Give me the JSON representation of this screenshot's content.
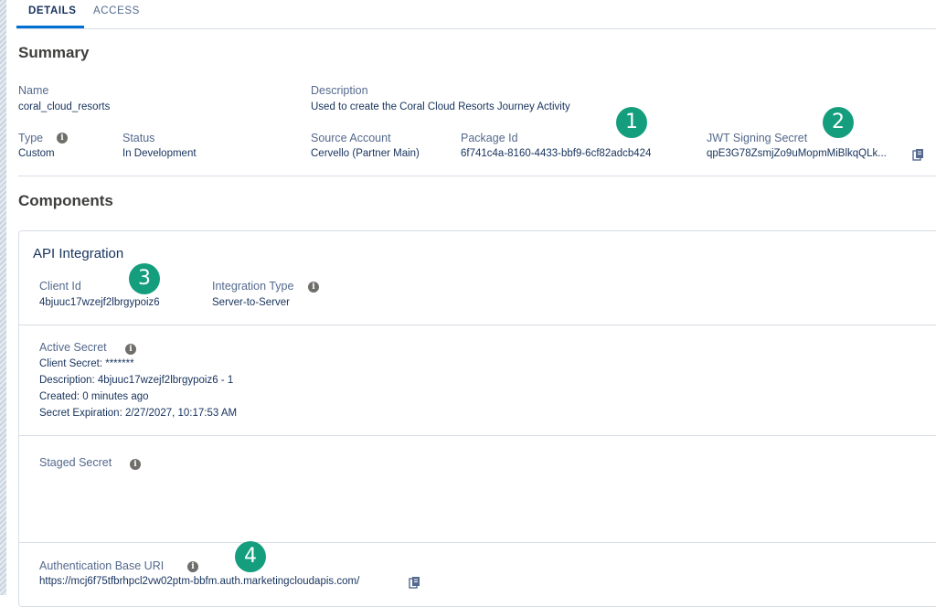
{
  "tabs": [
    {
      "label": "DETAILS",
      "active": true
    },
    {
      "label": "ACCESS",
      "active": false
    }
  ],
  "summary": {
    "title": "Summary",
    "name_label": "Name",
    "name_value": "coral_cloud_resorts",
    "description_label": "Description",
    "description_value": "Used to create the Coral Cloud Resorts Journey Activity",
    "type_label": "Type",
    "type_value": "Custom",
    "status_label": "Status",
    "status_value": "In Development",
    "source_account_label": "Source Account",
    "source_account_value": "Cervello (Partner Main)",
    "package_id_label": "Package Id",
    "package_id_value": "6f741c4a-8160-4433-bbf9-6cf82adcb424",
    "jwt_label": "JWT Signing Secret",
    "jwt_value": "qpE3G78ZsmjZo9uMopmMiBlkqQLk..."
  },
  "components": {
    "title": "Components",
    "api_integration": {
      "title": "API Integration",
      "client_id_label": "Client Id",
      "client_id_value": "4bjuuc17wzejf2lbrgypoiz6",
      "integration_type_label": "Integration Type",
      "integration_type_value": "Server-to-Server",
      "active_secret_label": "Active Secret",
      "active_secret_lines": [
        "Client Secret: *******",
        "Description: 4bjuuc17wzejf2lbrgypoiz6 - 1",
        "Created: 0 minutes ago",
        "Secret Expiration: 2/27/2027, 10:17:53 AM"
      ],
      "staged_secret_label": "Staged Secret",
      "auth_base_uri_label": "Authentication Base URI",
      "auth_base_uri_value": "https://mcj6f75tfbrhpcl2vw02ptm-bbfm.auth.marketingcloudapis.com/"
    }
  },
  "annotations": [
    "1",
    "2",
    "3",
    "4"
  ],
  "icons": {
    "info": "info-icon",
    "copy": "copy-icon"
  },
  "colors": {
    "accent": "#0070d2",
    "badge": "#149e7e",
    "text": "#16325c",
    "label": "#54698d"
  }
}
